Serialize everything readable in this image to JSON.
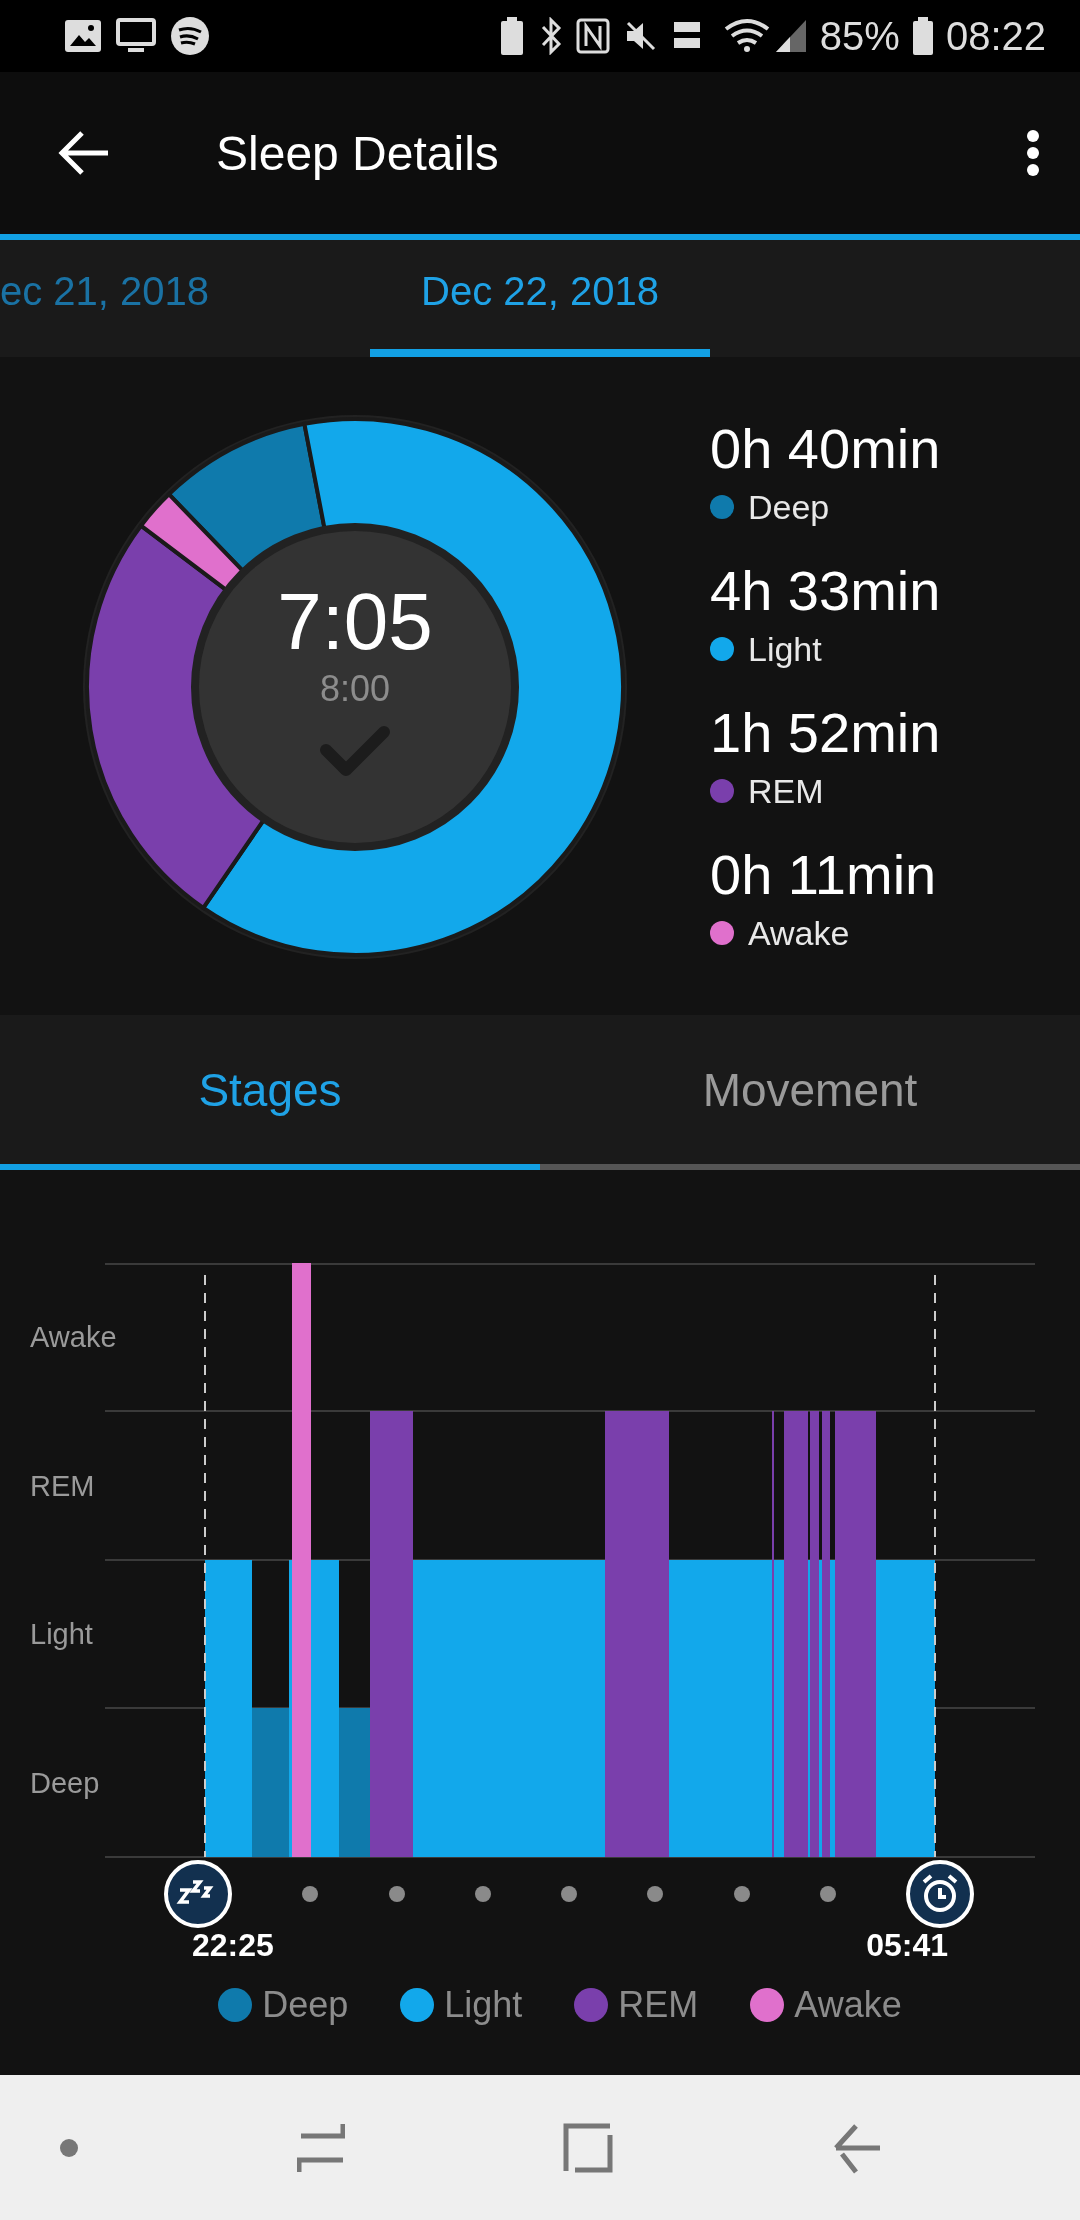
{
  "status_bar": {
    "battery": "85%",
    "time": "08:22"
  },
  "app_bar": {
    "title": "Sleep Details"
  },
  "date_tabs": [
    {
      "label": "ec 21, 2018",
      "selected": false
    },
    {
      "label": "Dec 22, 2018",
      "selected": true
    }
  ],
  "summary": {
    "total": "7:05",
    "goal": "8:00",
    "goal_met": true,
    "chart_data": {
      "type": "donut",
      "values": [
        9.2,
        62.6,
        25.7,
        2.5
      ]
    },
    "stages": [
      {
        "duration": "0h 40min",
        "label": "Deep",
        "color": "#0f7aac"
      },
      {
        "duration": "4h 33min",
        "label": "Light",
        "color": "#12a8eb"
      },
      {
        "duration": "1h 52min",
        "label": "REM",
        "color": "#7a3fac"
      },
      {
        "duration": "0h 11min",
        "label": "Awake",
        "color": "#e070cc"
      }
    ]
  },
  "view_tabs": [
    {
      "label": "Stages",
      "selected": true
    },
    {
      "label": "Movement",
      "selected": false
    }
  ],
  "stage_chart": {
    "y_labels": [
      "Awake",
      "REM",
      "Light",
      "Deep"
    ],
    "start_time": "22:25",
    "end_time": "05:41"
  },
  "legend": [
    {
      "label": "Deep",
      "color": "#0f7aac"
    },
    {
      "label": "Light",
      "color": "#12a8eb"
    },
    {
      "label": "REM",
      "color": "#7a3fac"
    },
    {
      "label": "Awake",
      "color": "#e070cc"
    }
  ]
}
